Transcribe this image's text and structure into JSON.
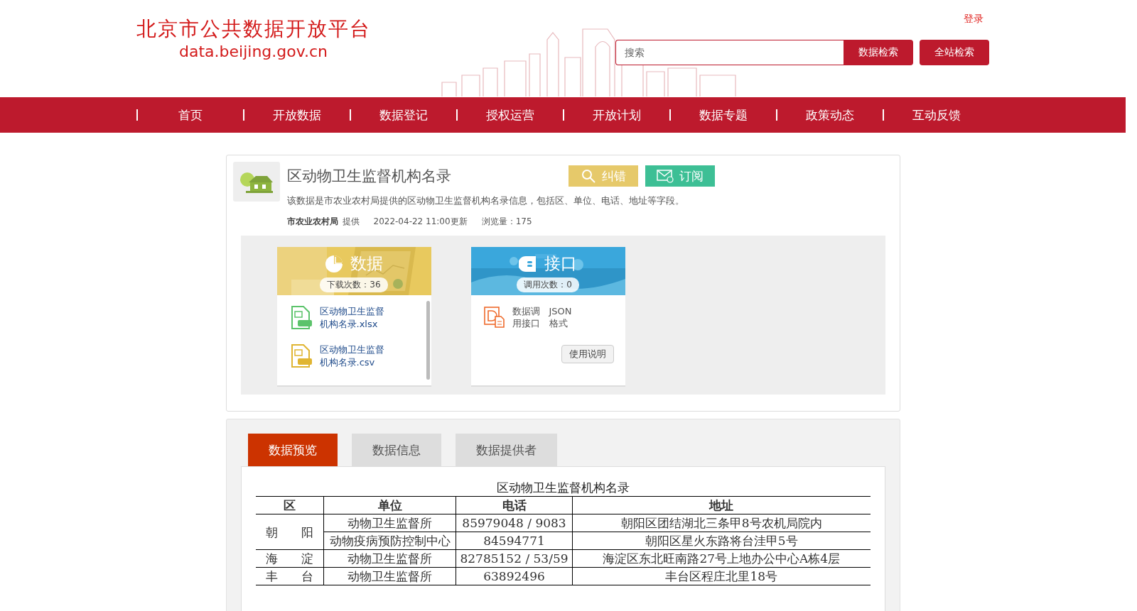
{
  "header": {
    "logo_title": "北京市公共数据开放平台",
    "logo_url": "data.beijing.gov.cn",
    "login": "登录",
    "search": {
      "placeholder": "搜索"
    },
    "search_button": "数据检索",
    "site_button": "全站检索"
  },
  "nav": [
    "首页",
    "开放数据",
    "数据登记",
    "授权运营",
    "开放计划",
    "数据专题",
    "政策动态",
    "互动反馈"
  ],
  "dataset": {
    "title": "区动物卫生监督机构名录",
    "actions": [
      {
        "label": "纠错",
        "kind": "correct"
      },
      {
        "label": "订阅",
        "kind": "subscribe"
      }
    ],
    "description": "该数据是市农业农村局提供的区动物卫生监督机构名录信息，包括区、单位、电话、地址等字段。",
    "provider": "市农业农村局",
    "provider_suffix": "提供",
    "updated": "2022-04-22 11:00更新",
    "views": "浏览量：175"
  },
  "data_card": {
    "title": "数据",
    "count": "下载次数：36",
    "files": [
      {
        "name": "区动物卫生监督机构名录.xlsx",
        "kind": "xls"
      },
      {
        "name": "区动物卫生监督机构名录.csv",
        "kind": "csv"
      }
    ]
  },
  "api_card": {
    "title": "接口",
    "count": "调用次数：0",
    "label": "数据调用接口",
    "format": "JSON格式",
    "button": "使用说明"
  },
  "tabs": [
    {
      "label": "数据预览",
      "selected": true
    },
    {
      "label": "数据信息",
      "selected": false
    },
    {
      "label": "数据提供者",
      "selected": false
    }
  ],
  "table": {
    "caption": "区动物卫生监督机构名录",
    "columns": [
      "区",
      "单位",
      "电话",
      "地址"
    ],
    "groups": [
      {
        "district": "朝阳",
        "rows": [
          {
            "unit": "动物卫生监督所",
            "phone": "85979048 / 9083",
            "address": "朝阳区团结湖北三条甲8号农机局院内"
          },
          {
            "unit": "动物疫病预防控制中心",
            "phone": "84594771",
            "address": "朝阳区星火东路将台洼甲5号"
          }
        ]
      },
      {
        "district": "海淀",
        "rows": [
          {
            "unit": "动物卫生监督所",
            "phone": "82785152 / 53/59",
            "address": "海淀区东北旺南路27号上地办公中心A栋4层"
          }
        ]
      },
      {
        "district": "丰台",
        "rows": [
          {
            "unit": "动物卫生监督所",
            "phone": "63892496",
            "address": "丰台区程庄北里18号"
          }
        ]
      }
    ]
  }
}
